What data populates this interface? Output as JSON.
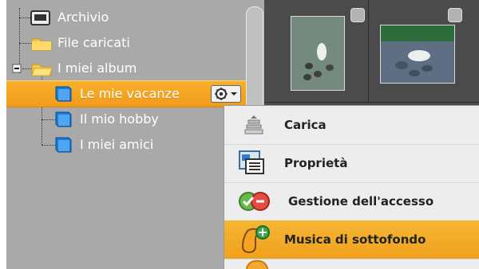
{
  "tree": [
    {
      "label": "Archivio",
      "icon": "archive-icon"
    },
    {
      "label": "File caricati",
      "icon": "folder-icon"
    },
    {
      "label": "I miei album",
      "icon": "folder-open-icon"
    },
    {
      "label": "Le mie vacanze",
      "icon": "book-icon"
    },
    {
      "label": "Il mio hobby",
      "icon": "book-icon"
    },
    {
      "label": "I miei amici",
      "icon": "book-icon"
    }
  ],
  "context_menu": {
    "items": [
      {
        "label": "Carica",
        "icon": "upload-icon"
      },
      {
        "label": "Proprietà",
        "icon": "properties-icon"
      },
      {
        "label": "Gestione dell'accesso",
        "icon": "access-icon"
      },
      {
        "label": "Musica di sottofondo",
        "icon": "music-icon"
      }
    ]
  },
  "colors": {
    "selection": "#f3a21e",
    "panel": "#a9a9a9",
    "thumb_bg": "#4b4b4b"
  }
}
